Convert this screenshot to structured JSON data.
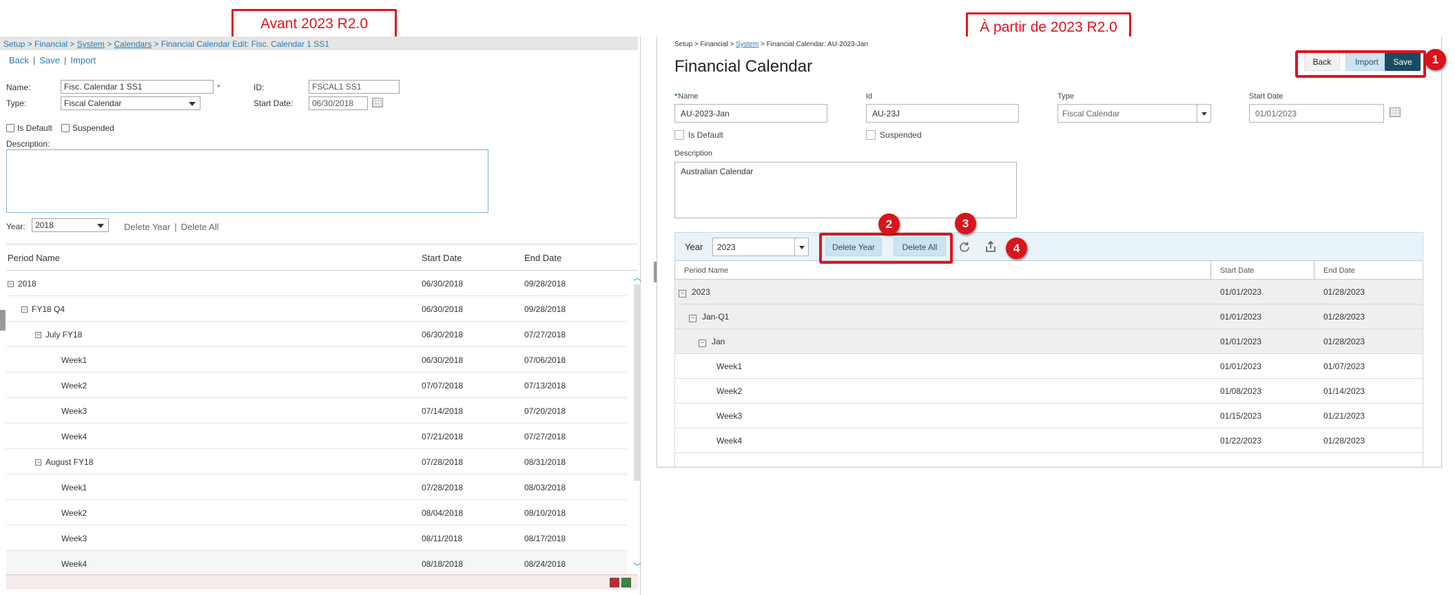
{
  "annotations": {
    "before_title": "Avant 2023 R2.0",
    "after_title": "À partir de 2023 R2.0",
    "callouts": [
      "1",
      "2",
      "3",
      "4"
    ]
  },
  "old_ui": {
    "breadcrumb": {
      "setup": "Setup",
      "sep1": " > ",
      "financial": "Financial",
      "sep2": " > ",
      "system": "System",
      "sep3": " > ",
      "calendars": "Calendars",
      "sep4": " > ",
      "current": "Financial Calendar Edit: Fisc. Calendar 1 SS1"
    },
    "actions": {
      "back": "Back",
      "save": "Save",
      "import": "Import",
      "sep": "|"
    },
    "form": {
      "name_label": "Name:",
      "name_value": "Fisc. Calendar 1 SS1",
      "required_mark": "*",
      "id_label": "ID:",
      "id_value": "FSCAL1 SS1",
      "type_label": "Type:",
      "type_value": "Fiscal Calendar",
      "start_label": "Start Date:",
      "start_value": "06/30/2018",
      "is_default": "Is Default",
      "suspended": "Suspended",
      "description_label": "Description:",
      "year_label": "Year:",
      "year_value": "2018",
      "delete_year": "Delete Year",
      "delete_all": "Delete All",
      "sep": "|"
    },
    "grid": {
      "headers": [
        "Period Name",
        "Start Date",
        "End Date"
      ],
      "rows": [
        {
          "name": "2018",
          "start": "06/30/2018",
          "end": "09/28/2018",
          "toggle": "−"
        },
        {
          "name": "FY18 Q4",
          "start": "06/30/2018",
          "end": "09/28/2018",
          "toggle": "−"
        },
        {
          "name": "July FY18",
          "start": "06/30/2018",
          "end": "07/27/2018",
          "toggle": "−"
        },
        {
          "name": "Week1",
          "start": "06/30/2018",
          "end": "07/06/2018"
        },
        {
          "name": "Week2",
          "start": "07/07/2018",
          "end": "07/13/2018"
        },
        {
          "name": "Week3",
          "start": "07/14/2018",
          "end": "07/20/2018"
        },
        {
          "name": "Week4",
          "start": "07/21/2018",
          "end": "07/27/2018"
        },
        {
          "name": "August FY18",
          "start": "07/28/2018",
          "end": "08/31/2018",
          "toggle": "−"
        },
        {
          "name": "Week1",
          "start": "07/28/2018",
          "end": "08/03/2018"
        },
        {
          "name": "Week2",
          "start": "08/04/2018",
          "end": "08/10/2018"
        },
        {
          "name": "Week3",
          "start": "08/11/2018",
          "end": "08/17/2018"
        },
        {
          "name": "Week4",
          "start": "08/18/2018",
          "end": "08/24/2018"
        }
      ]
    }
  },
  "new_ui": {
    "breadcrumb": {
      "pre": "Setup > Financial > ",
      "system": "System",
      "post": " > Financial Calendar: AU-2023-Jan"
    },
    "title": "Financial Calendar",
    "buttons": {
      "back": "Back",
      "import": "Import",
      "save": "Save"
    },
    "form": {
      "required_mark": "*",
      "name_label": "Name",
      "name_value": "AU-2023-Jan",
      "id_label": "Id",
      "id_value": "AU-23J",
      "type_label": "Type",
      "type_value": "Fiscal Calendar",
      "start_label": "Start Date",
      "start_value": "01/01/2023",
      "is_default": "Is Default",
      "suspended": "Suspended",
      "description_label": "Description",
      "description_value": "Australian Calendar"
    },
    "toolbar": {
      "year_label": "Year",
      "year_value": "2023",
      "delete_year": "Delete Year",
      "delete_all": "Delete All"
    },
    "grid": {
      "headers": [
        "Period Name",
        "Start Date",
        "End Date"
      ],
      "rows": [
        {
          "name": "2023",
          "start": "01/01/2023",
          "end": "01/28/2023",
          "toggle": "−"
        },
        {
          "name": "Jan-Q1",
          "start": "01/01/2023",
          "end": "01/28/2023",
          "toggle": "−"
        },
        {
          "name": "Jan",
          "start": "01/01/2023",
          "end": "01/28/2023",
          "toggle": "−"
        },
        {
          "name": "Week1",
          "start": "01/01/2023",
          "end": "01/07/2023"
        },
        {
          "name": "Week2",
          "start": "01/08/2023",
          "end": "01/14/2023"
        },
        {
          "name": "Week3",
          "start": "01/15/2023",
          "end": "01/21/2023"
        },
        {
          "name": "Week4",
          "start": "01/22/2023",
          "end": "01/28/2023"
        }
      ]
    }
  }
}
